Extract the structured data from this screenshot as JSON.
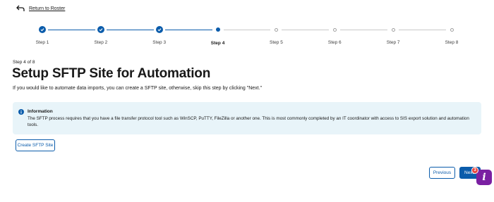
{
  "nav": {
    "back_label": "Return to Roster"
  },
  "stepper": {
    "steps": [
      {
        "label": "Step 1",
        "status": "done"
      },
      {
        "label": "Step 2",
        "status": "done"
      },
      {
        "label": "Step 3",
        "status": "done"
      },
      {
        "label": "Step 4",
        "status": "current"
      },
      {
        "label": "Step 5",
        "status": "todo"
      },
      {
        "label": "Step 6",
        "status": "todo"
      },
      {
        "label": "Step 7",
        "status": "todo"
      },
      {
        "label": "Step 8",
        "status": "todo"
      }
    ]
  },
  "main": {
    "step_count": "Step 4 of 8",
    "title": "Setup SFTP Site for Automation",
    "description": "If you would like to automate data imports, you can create a SFTP site, otherwise, skip this step by clicking \"Next.\""
  },
  "info": {
    "icon": "info-icon",
    "title": "Information",
    "body": "The SFTP process requires that you have a file transfer protocol tool such as WinSCP, PuTTY, FileZilla or another one. This is most commonly completed by an IT coordinator with access to SIS export solution and automation tools."
  },
  "actions": {
    "create_label": "Create SFTP Site",
    "previous_label": "Previous",
    "next_label": "Next"
  },
  "help": {
    "badge_count": "3",
    "glyph": "i"
  },
  "colors": {
    "accent": "#0b5cab",
    "info_bg": "#e8f4f9",
    "help": "#7a1fa2",
    "badge": "#e8443b"
  }
}
